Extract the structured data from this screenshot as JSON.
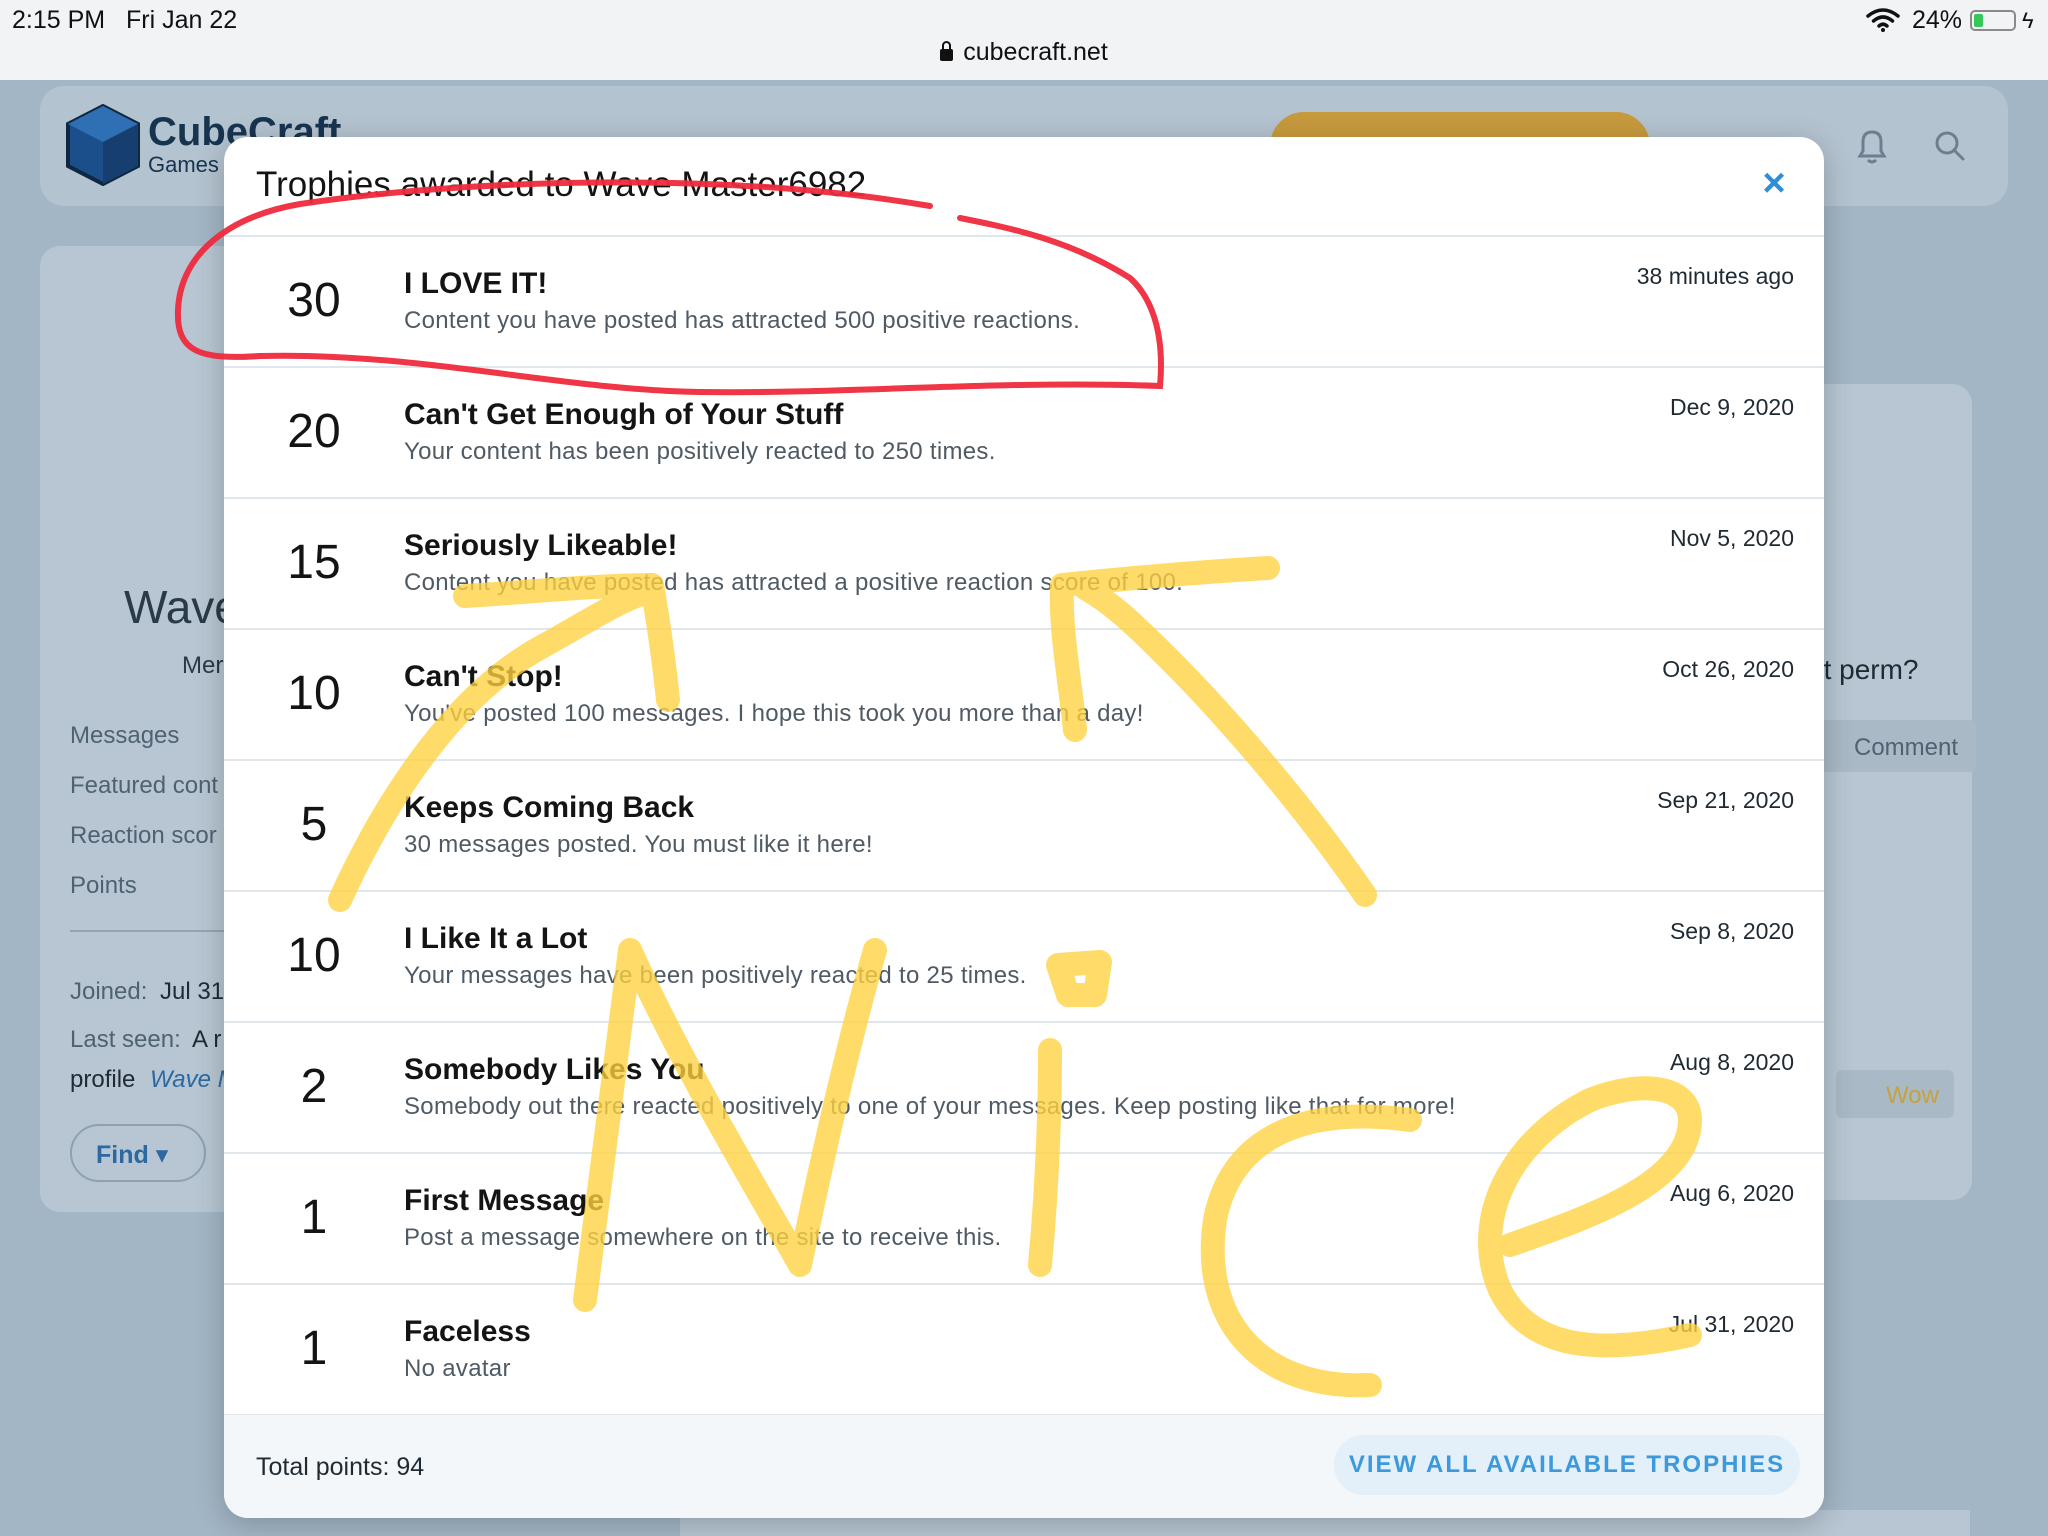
{
  "status_bar": {
    "time": "2:15 PM",
    "date": "Fri Jan 22",
    "url": "cubecraft.net",
    "battery": "24%",
    "battery_level": 0.24
  },
  "background_page": {
    "logo_text": "CubeCraft",
    "logo_sub": "Games",
    "user_name": "Wave",
    "role": "Mer",
    "stats": [
      "Messages",
      "Featured cont",
      "Reaction scor",
      "Points"
    ],
    "joined_label": "Joined:",
    "joined_value": "Jul 31",
    "last_seen_label": "Last seen:",
    "last_seen_value": "A r",
    "profile_label": "profile",
    "profile_link": "Wave M",
    "find_button": "Find",
    "right_question": "ot perm?",
    "comment_button": "Comment",
    "wow_reaction": "Wow"
  },
  "modal": {
    "title": "Trophies awarded to Wave Master6982",
    "close_label": "×",
    "trophies": [
      {
        "points": "30",
        "title": "I LOVE IT!",
        "description": "Content you have posted has attracted 500 positive reactions.",
        "date": "38 minutes ago"
      },
      {
        "points": "20",
        "title": "Can't Get Enough of Your Stuff",
        "description": "Your content has been positively reacted to 250 times.",
        "date": "Dec 9, 2020"
      },
      {
        "points": "15",
        "title": "Seriously Likeable!",
        "description": "Content you have posted has attracted a positive reaction score of 100.",
        "date": "Nov 5, 2020"
      },
      {
        "points": "10",
        "title": "Can't Stop!",
        "description": "You've posted 100 messages. I hope this took you more than a day!",
        "date": "Oct 26, 2020"
      },
      {
        "points": "5",
        "title": "Keeps Coming Back",
        "description": "30 messages posted. You must like it here!",
        "date": "Sep 21, 2020"
      },
      {
        "points": "10",
        "title": "I Like It a Lot",
        "description": "Your messages have been positively reacted to 25 times.",
        "date": "Sep 8, 2020"
      },
      {
        "points": "2",
        "title": "Somebody Likes You",
        "description": "Somebody out there reacted positively to one of your messages. Keep posting like that for more!",
        "date": "Aug 8, 2020"
      },
      {
        "points": "1",
        "title": "First Message",
        "description": "Post a message somewhere on the site to receive this.",
        "date": "Aug 6, 2020"
      },
      {
        "points": "1",
        "title": "Faceless",
        "description": "No avatar",
        "date": "Jul 31, 2020"
      }
    ],
    "total_points": "Total points: 94",
    "view_all_button": "VIEW ALL AVAILABLE TROPHIES"
  },
  "colors": {
    "accent_blue": "#2f8fd6",
    "red_marker": "#ee2a3c",
    "yellow_marker": "#ffd23f"
  }
}
